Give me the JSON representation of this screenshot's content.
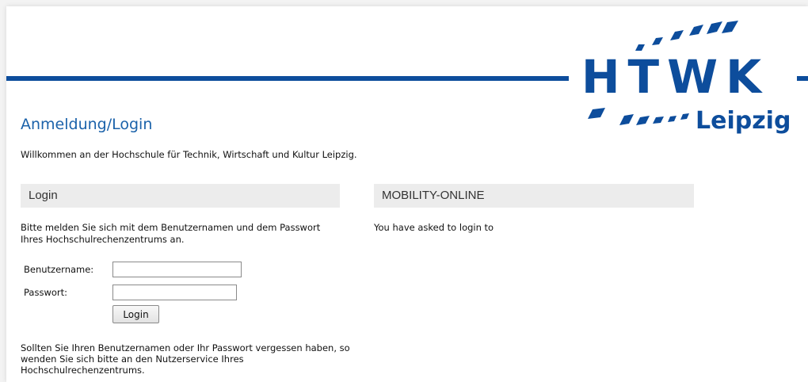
{
  "logo": {
    "letters": "HTWK",
    "city": "Leipzig"
  },
  "heading": "Anmeldung/Login",
  "welcome": "Willkommen an der Hochschule für Technik, Wirtschaft und Kultur Leipzig.",
  "login_section": {
    "header": "Login",
    "intro": "Bitte melden Sie sich mit dem Benutzernamen und dem Passwort Ihres Hochschulrechenzentrums an.",
    "username_label": "Benutzername:",
    "username_value": "",
    "password_label": "Passwort:",
    "password_value": "",
    "button_label": "Login",
    "forgot_text": "Sollten Sie Ihren Benutzernamen oder Ihr Passwort vergessen haben, so wenden Sie sich bitte an den Nutzerservice Ihres Hochschulrechenzentrums."
  },
  "mobility_section": {
    "header": "MOBILITY-ONLINE",
    "text": "You have asked to login to"
  },
  "colors": {
    "brand_blue": "#0d4d9c",
    "heading_blue": "#1b62aa",
    "section_bg": "#ececec"
  }
}
